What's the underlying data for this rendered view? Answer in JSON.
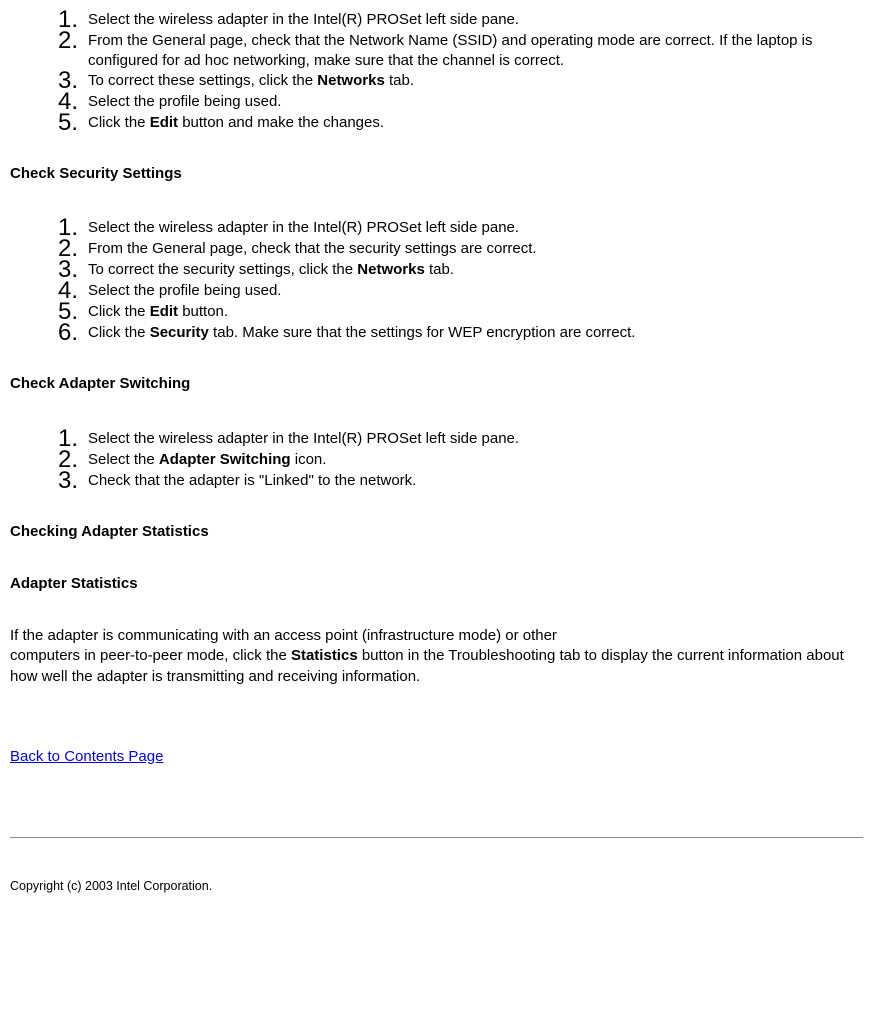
{
  "list1": {
    "items": [
      {
        "num": "1.",
        "text": "Select the wireless adapter in the Intel(R) PROSet left side pane."
      },
      {
        "num": "2.",
        "text": "From the General page, check that the Network Name (SSID) and operating mode are correct. If the laptop is configured for ad hoc networking, make sure that the channel is correct."
      },
      {
        "num": "3.",
        "text_pre": "To correct these settings, click the ",
        "bold": "Networks",
        "text_post": " tab."
      },
      {
        "num": "4.",
        "text": "Select the profile being used."
      },
      {
        "num": "5.",
        "text_pre": "Click the ",
        "bold": "Edit",
        "text_post": " button and make the changes."
      }
    ]
  },
  "h1": "Check Security Settings",
  "list2": {
    "items": [
      {
        "num": "1.",
        "text": "Select the wireless adapter in the Intel(R) PROSet left side pane."
      },
      {
        "num": "2.",
        "text": "From the General page, check that the security settings are correct."
      },
      {
        "num": "3.",
        "text_pre": "To correct the security settings, click the ",
        "bold": "Networks",
        "text_post": " tab."
      },
      {
        "num": "4.",
        "text": "Select the profile being used."
      },
      {
        "num": "5.",
        "text_pre": "Click the ",
        "bold": "Edit",
        "text_post": " button."
      },
      {
        "num": "6.",
        "text_pre": "Click the ",
        "bold": "Security",
        "text_post": " tab. Make sure that the settings for WEP encryption are correct."
      }
    ]
  },
  "h2": "Check Adapter Switching",
  "list3": {
    "items": [
      {
        "num": "1.",
        "text": "Select the wireless adapter in the Intel(R) PROSet left side pane."
      },
      {
        "num": "2.",
        "text_pre": "Select the ",
        "bold": "Adapter Switching",
        "text_post": " icon."
      },
      {
        "num": "3.",
        "text": "Check that the adapter is \"Linked\" to the network."
      }
    ]
  },
  "h3": "Checking Adapter Statistics",
  "h4": "Adapter Statistics",
  "para_pre": "If the adapter is communicating with an access point (infrastructure mode) or other\ncomputers in peer-to-peer mode, click the ",
  "para_bold": "Statistics",
  "para_post": " button in the Troubleshooting tab to display the current information about how well the adapter is transmitting and receiving information.",
  "link": "Back to Contents Page",
  "copyright": "Copyright (c) 2003 Intel Corporation."
}
